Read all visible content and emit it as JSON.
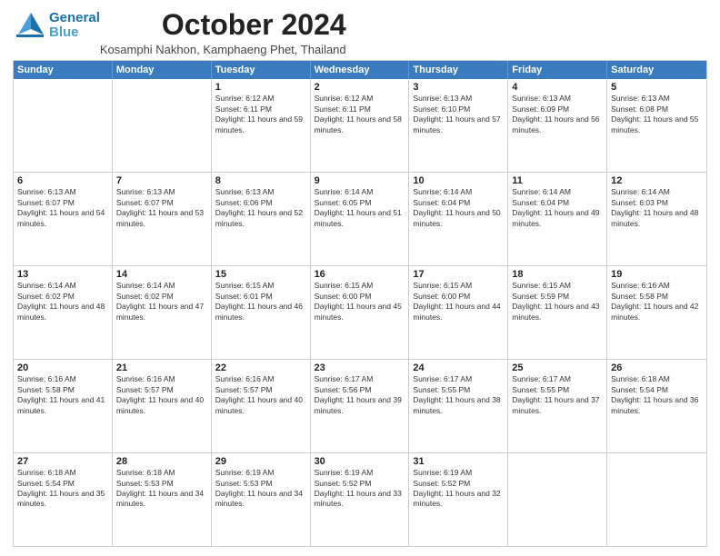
{
  "header": {
    "logo_line1": "General",
    "logo_line2": "Blue",
    "month": "October 2024",
    "location": "Kosamphi Nakhon, Kamphaeng Phet, Thailand"
  },
  "days_of_week": [
    "Sunday",
    "Monday",
    "Tuesday",
    "Wednesday",
    "Thursday",
    "Friday",
    "Saturday"
  ],
  "weeks": [
    [
      {
        "day": "",
        "sunrise": "",
        "sunset": "",
        "daylight": ""
      },
      {
        "day": "",
        "sunrise": "",
        "sunset": "",
        "daylight": ""
      },
      {
        "day": "1",
        "sunrise": "Sunrise: 6:12 AM",
        "sunset": "Sunset: 6:11 PM",
        "daylight": "Daylight: 11 hours and 59 minutes."
      },
      {
        "day": "2",
        "sunrise": "Sunrise: 6:12 AM",
        "sunset": "Sunset: 6:11 PM",
        "daylight": "Daylight: 11 hours and 58 minutes."
      },
      {
        "day": "3",
        "sunrise": "Sunrise: 6:13 AM",
        "sunset": "Sunset: 6:10 PM",
        "daylight": "Daylight: 11 hours and 57 minutes."
      },
      {
        "day": "4",
        "sunrise": "Sunrise: 6:13 AM",
        "sunset": "Sunset: 6:09 PM",
        "daylight": "Daylight: 11 hours and 56 minutes."
      },
      {
        "day": "5",
        "sunrise": "Sunrise: 6:13 AM",
        "sunset": "Sunset: 6:08 PM",
        "daylight": "Daylight: 11 hours and 55 minutes."
      }
    ],
    [
      {
        "day": "6",
        "sunrise": "Sunrise: 6:13 AM",
        "sunset": "Sunset: 6:07 PM",
        "daylight": "Daylight: 11 hours and 54 minutes."
      },
      {
        "day": "7",
        "sunrise": "Sunrise: 6:13 AM",
        "sunset": "Sunset: 6:07 PM",
        "daylight": "Daylight: 11 hours and 53 minutes."
      },
      {
        "day": "8",
        "sunrise": "Sunrise: 6:13 AM",
        "sunset": "Sunset: 6:06 PM",
        "daylight": "Daylight: 11 hours and 52 minutes."
      },
      {
        "day": "9",
        "sunrise": "Sunrise: 6:14 AM",
        "sunset": "Sunset: 6:05 PM",
        "daylight": "Daylight: 11 hours and 51 minutes."
      },
      {
        "day": "10",
        "sunrise": "Sunrise: 6:14 AM",
        "sunset": "Sunset: 6:04 PM",
        "daylight": "Daylight: 11 hours and 50 minutes."
      },
      {
        "day": "11",
        "sunrise": "Sunrise: 6:14 AM",
        "sunset": "Sunset: 6:04 PM",
        "daylight": "Daylight: 11 hours and 49 minutes."
      },
      {
        "day": "12",
        "sunrise": "Sunrise: 6:14 AM",
        "sunset": "Sunset: 6:03 PM",
        "daylight": "Daylight: 11 hours and 48 minutes."
      }
    ],
    [
      {
        "day": "13",
        "sunrise": "Sunrise: 6:14 AM",
        "sunset": "Sunset: 6:02 PM",
        "daylight": "Daylight: 11 hours and 48 minutes."
      },
      {
        "day": "14",
        "sunrise": "Sunrise: 6:14 AM",
        "sunset": "Sunset: 6:02 PM",
        "daylight": "Daylight: 11 hours and 47 minutes."
      },
      {
        "day": "15",
        "sunrise": "Sunrise: 6:15 AM",
        "sunset": "Sunset: 6:01 PM",
        "daylight": "Daylight: 11 hours and 46 minutes."
      },
      {
        "day": "16",
        "sunrise": "Sunrise: 6:15 AM",
        "sunset": "Sunset: 6:00 PM",
        "daylight": "Daylight: 11 hours and 45 minutes."
      },
      {
        "day": "17",
        "sunrise": "Sunrise: 6:15 AM",
        "sunset": "Sunset: 6:00 PM",
        "daylight": "Daylight: 11 hours and 44 minutes."
      },
      {
        "day": "18",
        "sunrise": "Sunrise: 6:15 AM",
        "sunset": "Sunset: 5:59 PM",
        "daylight": "Daylight: 11 hours and 43 minutes."
      },
      {
        "day": "19",
        "sunrise": "Sunrise: 6:16 AM",
        "sunset": "Sunset: 5:58 PM",
        "daylight": "Daylight: 11 hours and 42 minutes."
      }
    ],
    [
      {
        "day": "20",
        "sunrise": "Sunrise: 6:16 AM",
        "sunset": "Sunset: 5:58 PM",
        "daylight": "Daylight: 11 hours and 41 minutes."
      },
      {
        "day": "21",
        "sunrise": "Sunrise: 6:16 AM",
        "sunset": "Sunset: 5:57 PM",
        "daylight": "Daylight: 11 hours and 40 minutes."
      },
      {
        "day": "22",
        "sunrise": "Sunrise: 6:16 AM",
        "sunset": "Sunset: 5:57 PM",
        "daylight": "Daylight: 11 hours and 40 minutes."
      },
      {
        "day": "23",
        "sunrise": "Sunrise: 6:17 AM",
        "sunset": "Sunset: 5:56 PM",
        "daylight": "Daylight: 11 hours and 39 minutes."
      },
      {
        "day": "24",
        "sunrise": "Sunrise: 6:17 AM",
        "sunset": "Sunset: 5:55 PM",
        "daylight": "Daylight: 11 hours and 38 minutes."
      },
      {
        "day": "25",
        "sunrise": "Sunrise: 6:17 AM",
        "sunset": "Sunset: 5:55 PM",
        "daylight": "Daylight: 11 hours and 37 minutes."
      },
      {
        "day": "26",
        "sunrise": "Sunrise: 6:18 AM",
        "sunset": "Sunset: 5:54 PM",
        "daylight": "Daylight: 11 hours and 36 minutes."
      }
    ],
    [
      {
        "day": "27",
        "sunrise": "Sunrise: 6:18 AM",
        "sunset": "Sunset: 5:54 PM",
        "daylight": "Daylight: 11 hours and 35 minutes."
      },
      {
        "day": "28",
        "sunrise": "Sunrise: 6:18 AM",
        "sunset": "Sunset: 5:53 PM",
        "daylight": "Daylight: 11 hours and 34 minutes."
      },
      {
        "day": "29",
        "sunrise": "Sunrise: 6:19 AM",
        "sunset": "Sunset: 5:53 PM",
        "daylight": "Daylight: 11 hours and 34 minutes."
      },
      {
        "day": "30",
        "sunrise": "Sunrise: 6:19 AM",
        "sunset": "Sunset: 5:52 PM",
        "daylight": "Daylight: 11 hours and 33 minutes."
      },
      {
        "day": "31",
        "sunrise": "Sunrise: 6:19 AM",
        "sunset": "Sunset: 5:52 PM",
        "daylight": "Daylight: 11 hours and 32 minutes."
      },
      {
        "day": "",
        "sunrise": "",
        "sunset": "",
        "daylight": ""
      },
      {
        "day": "",
        "sunrise": "",
        "sunset": "",
        "daylight": ""
      }
    ]
  ]
}
